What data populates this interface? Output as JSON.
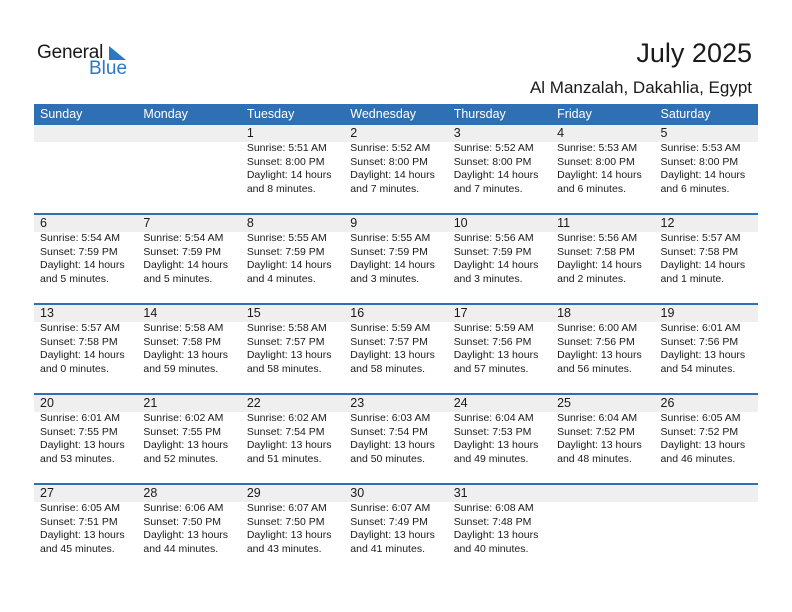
{
  "logo": {
    "text1": "General",
    "text2": "Blue"
  },
  "header": {
    "title": "July 2025",
    "location": "Al Manzalah, Dakahlia, Egypt"
  },
  "colors": {
    "accent": "#2e70b3",
    "band": "#efefef",
    "logo_blue": "#2a78c2"
  },
  "weekdays": [
    "Sunday",
    "Monday",
    "Tuesday",
    "Wednesday",
    "Thursday",
    "Friday",
    "Saturday"
  ],
  "weeks": [
    [
      {
        "day": "",
        "sunrise": "",
        "sunset": "",
        "daylight1": "",
        "daylight2": ""
      },
      {
        "day": "",
        "sunrise": "",
        "sunset": "",
        "daylight1": "",
        "daylight2": ""
      },
      {
        "day": "1",
        "sunrise": "Sunrise: 5:51 AM",
        "sunset": "Sunset: 8:00 PM",
        "daylight1": "Daylight: 14 hours",
        "daylight2": "and 8 minutes."
      },
      {
        "day": "2",
        "sunrise": "Sunrise: 5:52 AM",
        "sunset": "Sunset: 8:00 PM",
        "daylight1": "Daylight: 14 hours",
        "daylight2": "and 7 minutes."
      },
      {
        "day": "3",
        "sunrise": "Sunrise: 5:52 AM",
        "sunset": "Sunset: 8:00 PM",
        "daylight1": "Daylight: 14 hours",
        "daylight2": "and 7 minutes."
      },
      {
        "day": "4",
        "sunrise": "Sunrise: 5:53 AM",
        "sunset": "Sunset: 8:00 PM",
        "daylight1": "Daylight: 14 hours",
        "daylight2": "and 6 minutes."
      },
      {
        "day": "5",
        "sunrise": "Sunrise: 5:53 AM",
        "sunset": "Sunset: 8:00 PM",
        "daylight1": "Daylight: 14 hours",
        "daylight2": "and 6 minutes."
      }
    ],
    [
      {
        "day": "6",
        "sunrise": "Sunrise: 5:54 AM",
        "sunset": "Sunset: 7:59 PM",
        "daylight1": "Daylight: 14 hours",
        "daylight2": "and 5 minutes."
      },
      {
        "day": "7",
        "sunrise": "Sunrise: 5:54 AM",
        "sunset": "Sunset: 7:59 PM",
        "daylight1": "Daylight: 14 hours",
        "daylight2": "and 5 minutes."
      },
      {
        "day": "8",
        "sunrise": "Sunrise: 5:55 AM",
        "sunset": "Sunset: 7:59 PM",
        "daylight1": "Daylight: 14 hours",
        "daylight2": "and 4 minutes."
      },
      {
        "day": "9",
        "sunrise": "Sunrise: 5:55 AM",
        "sunset": "Sunset: 7:59 PM",
        "daylight1": "Daylight: 14 hours",
        "daylight2": "and 3 minutes."
      },
      {
        "day": "10",
        "sunrise": "Sunrise: 5:56 AM",
        "sunset": "Sunset: 7:59 PM",
        "daylight1": "Daylight: 14 hours",
        "daylight2": "and 3 minutes."
      },
      {
        "day": "11",
        "sunrise": "Sunrise: 5:56 AM",
        "sunset": "Sunset: 7:58 PM",
        "daylight1": "Daylight: 14 hours",
        "daylight2": "and 2 minutes."
      },
      {
        "day": "12",
        "sunrise": "Sunrise: 5:57 AM",
        "sunset": "Sunset: 7:58 PM",
        "daylight1": "Daylight: 14 hours",
        "daylight2": "and 1 minute."
      }
    ],
    [
      {
        "day": "13",
        "sunrise": "Sunrise: 5:57 AM",
        "sunset": "Sunset: 7:58 PM",
        "daylight1": "Daylight: 14 hours",
        "daylight2": "and 0 minutes."
      },
      {
        "day": "14",
        "sunrise": "Sunrise: 5:58 AM",
        "sunset": "Sunset: 7:58 PM",
        "daylight1": "Daylight: 13 hours",
        "daylight2": "and 59 minutes."
      },
      {
        "day": "15",
        "sunrise": "Sunrise: 5:58 AM",
        "sunset": "Sunset: 7:57 PM",
        "daylight1": "Daylight: 13 hours",
        "daylight2": "and 58 minutes."
      },
      {
        "day": "16",
        "sunrise": "Sunrise: 5:59 AM",
        "sunset": "Sunset: 7:57 PM",
        "daylight1": "Daylight: 13 hours",
        "daylight2": "and 58 minutes."
      },
      {
        "day": "17",
        "sunrise": "Sunrise: 5:59 AM",
        "sunset": "Sunset: 7:56 PM",
        "daylight1": "Daylight: 13 hours",
        "daylight2": "and 57 minutes."
      },
      {
        "day": "18",
        "sunrise": "Sunrise: 6:00 AM",
        "sunset": "Sunset: 7:56 PM",
        "daylight1": "Daylight: 13 hours",
        "daylight2": "and 56 minutes."
      },
      {
        "day": "19",
        "sunrise": "Sunrise: 6:01 AM",
        "sunset": "Sunset: 7:56 PM",
        "daylight1": "Daylight: 13 hours",
        "daylight2": "and 54 minutes."
      }
    ],
    [
      {
        "day": "20",
        "sunrise": "Sunrise: 6:01 AM",
        "sunset": "Sunset: 7:55 PM",
        "daylight1": "Daylight: 13 hours",
        "daylight2": "and 53 minutes."
      },
      {
        "day": "21",
        "sunrise": "Sunrise: 6:02 AM",
        "sunset": "Sunset: 7:55 PM",
        "daylight1": "Daylight: 13 hours",
        "daylight2": "and 52 minutes."
      },
      {
        "day": "22",
        "sunrise": "Sunrise: 6:02 AM",
        "sunset": "Sunset: 7:54 PM",
        "daylight1": "Daylight: 13 hours",
        "daylight2": "and 51 minutes."
      },
      {
        "day": "23",
        "sunrise": "Sunrise: 6:03 AM",
        "sunset": "Sunset: 7:54 PM",
        "daylight1": "Daylight: 13 hours",
        "daylight2": "and 50 minutes."
      },
      {
        "day": "24",
        "sunrise": "Sunrise: 6:04 AM",
        "sunset": "Sunset: 7:53 PM",
        "daylight1": "Daylight: 13 hours",
        "daylight2": "and 49 minutes."
      },
      {
        "day": "25",
        "sunrise": "Sunrise: 6:04 AM",
        "sunset": "Sunset: 7:52 PM",
        "daylight1": "Daylight: 13 hours",
        "daylight2": "and 48 minutes."
      },
      {
        "day": "26",
        "sunrise": "Sunrise: 6:05 AM",
        "sunset": "Sunset: 7:52 PM",
        "daylight1": "Daylight: 13 hours",
        "daylight2": "and 46 minutes."
      }
    ],
    [
      {
        "day": "27",
        "sunrise": "Sunrise: 6:05 AM",
        "sunset": "Sunset: 7:51 PM",
        "daylight1": "Daylight: 13 hours",
        "daylight2": "and 45 minutes."
      },
      {
        "day": "28",
        "sunrise": "Sunrise: 6:06 AM",
        "sunset": "Sunset: 7:50 PM",
        "daylight1": "Daylight: 13 hours",
        "daylight2": "and 44 minutes."
      },
      {
        "day": "29",
        "sunrise": "Sunrise: 6:07 AM",
        "sunset": "Sunset: 7:50 PM",
        "daylight1": "Daylight: 13 hours",
        "daylight2": "and 43 minutes."
      },
      {
        "day": "30",
        "sunrise": "Sunrise: 6:07 AM",
        "sunset": "Sunset: 7:49 PM",
        "daylight1": "Daylight: 13 hours",
        "daylight2": "and 41 minutes."
      },
      {
        "day": "31",
        "sunrise": "Sunrise: 6:08 AM",
        "sunset": "Sunset: 7:48 PM",
        "daylight1": "Daylight: 13 hours",
        "daylight2": "and 40 minutes."
      },
      {
        "day": "",
        "sunrise": "",
        "sunset": "",
        "daylight1": "",
        "daylight2": ""
      },
      {
        "day": "",
        "sunrise": "",
        "sunset": "",
        "daylight1": "",
        "daylight2": ""
      }
    ]
  ]
}
